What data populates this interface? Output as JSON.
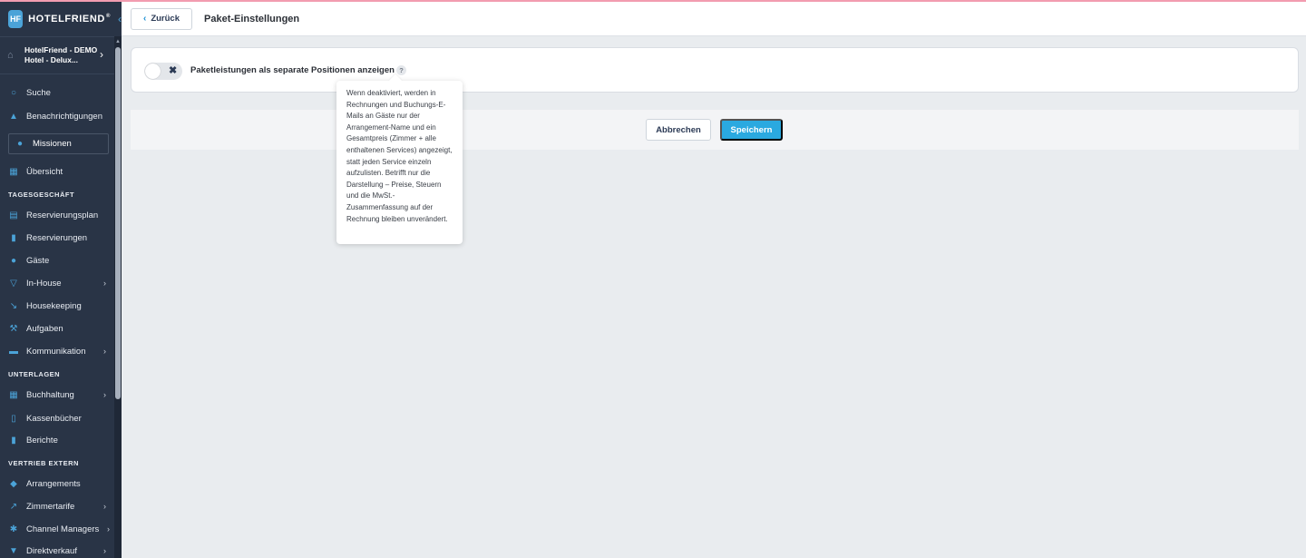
{
  "app": {
    "logo_mark": "HF",
    "logo_text": "HOTELFRIEND",
    "logo_sup": "®"
  },
  "hotel": {
    "line1": "HotelFriend - DEMO",
    "line2": "Hotel - Delux..."
  },
  "sidebar": {
    "search": "Suche",
    "notifications": "Benachrichtigungen",
    "missions": "Missionen",
    "overview": "Übersicht",
    "sections": {
      "daily": "TAGESGESCHÄFT",
      "documents": "UNTERLAGEN",
      "external": "VERTRIEB EXTERN"
    },
    "items": {
      "reservation_plan": "Reservierungsplan",
      "reservations": "Reservierungen",
      "guests": "Gäste",
      "in_house": "In-House",
      "housekeeping": "Housekeeping",
      "tasks": "Aufgaben",
      "communication": "Kommunikation",
      "accounting": "Buchhaltung",
      "cashbooks": "Kassenbücher",
      "reports": "Berichte",
      "arrangements": "Arrangements",
      "room_rates": "Zimmertarife",
      "channel_managers": "Channel Managers",
      "direct_sales": "Direktverkauf"
    }
  },
  "header": {
    "back_label": "Zurück",
    "title": "Paket-Einstellungen"
  },
  "setting": {
    "toggle_state": "off",
    "label": "Paketleistungen als separate Positionen anzeigen",
    "help": "?"
  },
  "tooltip": {
    "text": "Wenn deaktiviert, werden in Rechnungen und Buchungs-E-Mails an Gäste nur der Arrangement-Name und ein Gesamtpreis (Zimmer + alle enthaltenen Services) angezeigt, statt jeden Service einzeln aufzulisten. Betrifft nur die Darstellung – Preise, Steuern und die MwSt.-Zusammenfassung auf der Rechnung bleiben unverändert."
  },
  "actions": {
    "cancel": "Abbrechen",
    "save": "Speichern"
  },
  "colors": {
    "sidebar_bg": "#293446",
    "accent": "#2aa9e0",
    "page_bg": "#e9ecef"
  },
  "icons": {
    "logo": "hotel-cube-icon",
    "collapse": "chevron-left-icon",
    "back": "chevron-left-icon",
    "search": "search-icon",
    "notifications": "bell-icon",
    "missions": "person-icon",
    "overview": "grid-icon",
    "help": "question-icon",
    "toggle": "close-icon"
  }
}
